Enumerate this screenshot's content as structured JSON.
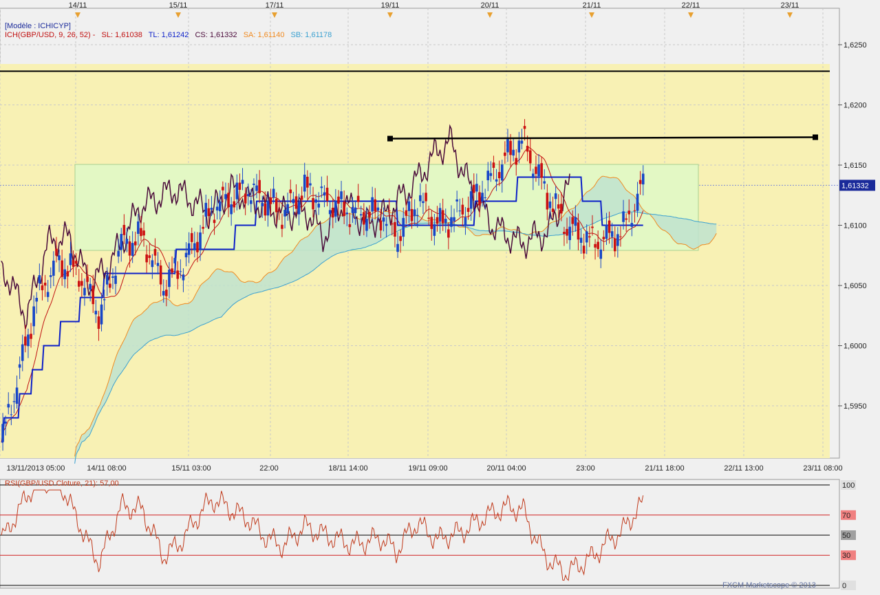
{
  "colors": {
    "background": "#f0f0f0",
    "plot_bg": "#f8f1b4",
    "rect_highlight": "#e3f8c4",
    "bull": "#1746c8",
    "bear": "#cc1111",
    "tenkan": "#c01010",
    "kijun": "#0b1fc8",
    "chikou": "#4a0a3a",
    "senkou_a": "#f08a20",
    "senkou_b": "#3aa0d0",
    "cloud_bull": "#bfe3cf",
    "cloud_bear": "#f7d39a",
    "rsi_line": "#c0391a",
    "level_line": "#000000",
    "price_tag": "#1a2a9a"
  },
  "header": {
    "model_label": "[Modèle : ICHICYP]",
    "ich_label": "ICH(GBP/USD, 9, 26, 52) -",
    "sl": "SL: 1,61038",
    "tl": "TL: 1,61242",
    "cs": "CS: 1,61332",
    "sa": "SA: 1,61140",
    "sb": "SB: 1,61178"
  },
  "top_dates": [
    "14/11",
    "15/11",
    "17/11",
    "19/11",
    "20/11",
    "21/11",
    "22/11",
    "23/11"
  ],
  "current_price": "1,61332",
  "rsi": {
    "label": "RSI(GBP/USD.Cloture, 21): 57,00",
    "levels": [
      "100",
      "70",
      "50",
      "30",
      "0"
    ]
  },
  "footer": {
    "credit": "FXCM Marketscope © 2013"
  },
  "chart_data": [
    {
      "type": "candlestick",
      "instrument": "GBP/USD",
      "title": "",
      "y_ticks": [
        "1,6250",
        "1,6200",
        "1,6150",
        "1,6100",
        "1,6050",
        "1,6000",
        "1,5950"
      ],
      "x_ticks": [
        "13/11/2013 05:00",
        "14/11 08:00",
        "15/11 03:00",
        "22:00",
        "18/11 14:00",
        "19/11 09:00",
        "20/11 04:00",
        "23:00",
        "21/11 18:00",
        "22/11 13:00",
        "23/11 08:00"
      ],
      "ylim": [
        1.5908,
        1.6285
      ],
      "grid": true,
      "horizontal_levels": [
        1.6228,
        1.6172
      ]
    },
    {
      "type": "line",
      "series": [
        {
          "name": "RSI(GBP/USD.Cloture, 21)",
          "last": 57.0
        }
      ],
      "ylim": [
        0,
        100
      ],
      "levels": [
        100,
        70,
        50,
        30,
        0
      ]
    }
  ]
}
